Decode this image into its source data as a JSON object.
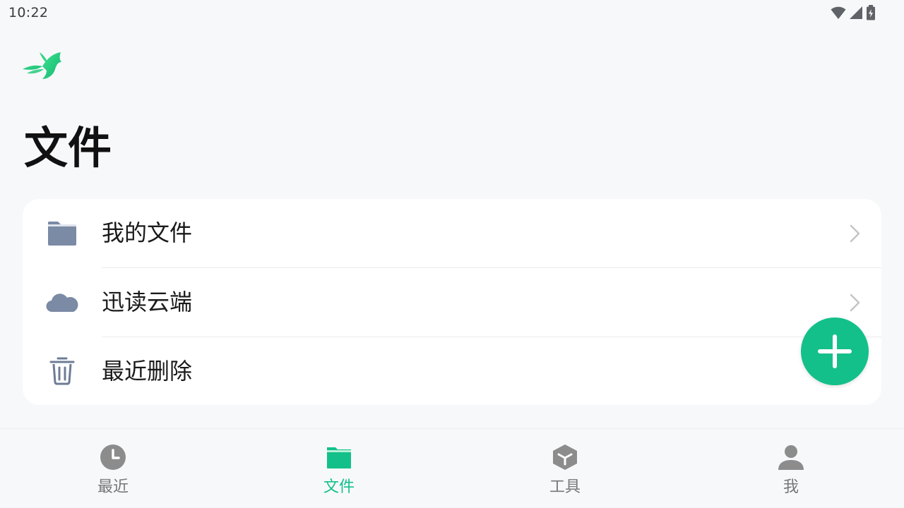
{
  "status_bar": {
    "time": "10:22",
    "icons": [
      "wifi-icon",
      "signal-icon",
      "battery-charging-icon"
    ]
  },
  "header": {
    "logo": "swallow-logo-icon",
    "title": "文件"
  },
  "file_menu": {
    "items": [
      {
        "label": "我的文件",
        "icon": "folder-icon",
        "has_chevron": true
      },
      {
        "label": "迅读云端",
        "icon": "cloud-icon",
        "has_chevron": true
      },
      {
        "label": "最近删除",
        "icon": "trash-icon",
        "has_chevron": false
      }
    ]
  },
  "fab": {
    "icon": "plus-icon"
  },
  "bottom_nav": {
    "active_index": 1,
    "items": [
      {
        "label": "最近",
        "icon": "clock-icon"
      },
      {
        "label": "文件",
        "icon": "folder-icon"
      },
      {
        "label": "工具",
        "icon": "box-icon"
      },
      {
        "label": "我",
        "icon": "person-icon"
      }
    ]
  },
  "colors": {
    "accent": "#13c08a",
    "background": "#f7f8fa",
    "card": "#ffffff",
    "icon_muted": "#7b8aa5",
    "nav_inactive": "#8c8c8c"
  }
}
